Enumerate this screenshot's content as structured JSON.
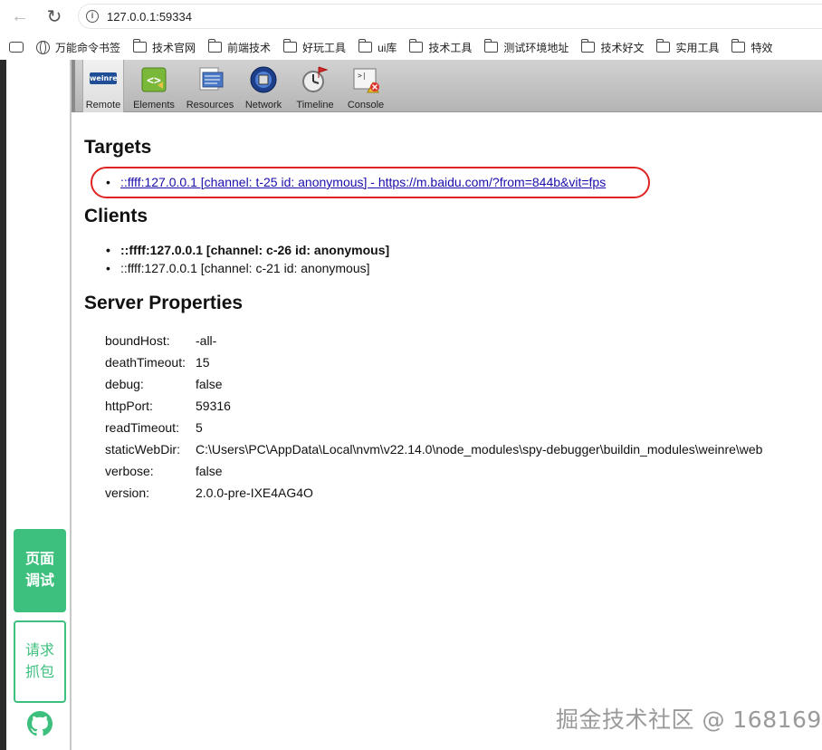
{
  "browser": {
    "url": "127.0.0.1:59334",
    "bookmarks": [
      {
        "label": "万能命令书签",
        "icon": "globe-icon"
      },
      {
        "label": "技术官网",
        "icon": "folder-icon"
      },
      {
        "label": "前端技术",
        "icon": "folder-icon"
      },
      {
        "label": "好玩工具",
        "icon": "folder-icon"
      },
      {
        "label": "ui库",
        "icon": "folder-icon"
      },
      {
        "label": "技术工具",
        "icon": "folder-icon"
      },
      {
        "label": "测试环境地址",
        "icon": "folder-icon"
      },
      {
        "label": "技术好文",
        "icon": "folder-icon"
      },
      {
        "label": "实用工具",
        "icon": "folder-icon"
      },
      {
        "label": "特效",
        "icon": "folder-icon"
      }
    ]
  },
  "side_panel": {
    "page_debug_label": "页面\n调试",
    "capture_label": "请求\n抓包",
    "accent_color": "#3dbf7e"
  },
  "toolbar": {
    "items": [
      {
        "label": "Remote",
        "icon": "weinre-logo-icon",
        "selected": true
      },
      {
        "label": "Elements",
        "icon": "elements-icon"
      },
      {
        "label": "Resources",
        "icon": "resources-icon"
      },
      {
        "label": "Network",
        "icon": "network-icon"
      },
      {
        "label": "Timeline",
        "icon": "timeline-icon"
      },
      {
        "label": "Console",
        "icon": "console-icon"
      }
    ],
    "logo_text": "weinre"
  },
  "targets": {
    "heading": "Targets",
    "items": [
      "::ffff:127.0.0.1 [channel: t-25 id: anonymous] - https://m.baidu.com/?from=844b&vit=fps"
    ]
  },
  "clients": {
    "heading": "Clients",
    "items": [
      {
        "text": "::ffff:127.0.0.1 [channel: c-26 id: anonymous]",
        "bold": true
      },
      {
        "text": "::ffff:127.0.0.1 [channel: c-21 id: anonymous]",
        "bold": false
      }
    ]
  },
  "server_properties": {
    "heading": "Server Properties",
    "props": [
      {
        "key": "boundHost:",
        "value": "-all-"
      },
      {
        "key": "deathTimeout:",
        "value": "15"
      },
      {
        "key": "debug:",
        "value": "false"
      },
      {
        "key": "httpPort:",
        "value": "59316"
      },
      {
        "key": "readTimeout:",
        "value": "5"
      },
      {
        "key": "staticWebDir:",
        "value": "C:\\Users\\PC\\AppData\\Local\\nvm\\v22.14.0\\node_modules\\spy-debugger\\buildin_modules\\weinre\\web"
      },
      {
        "key": "verbose:",
        "value": "false"
      },
      {
        "key": "version:",
        "value": "2.0.0-pre-IXE4AG4O"
      }
    ]
  },
  "watermark": "掘金技术社区 @ 168169"
}
